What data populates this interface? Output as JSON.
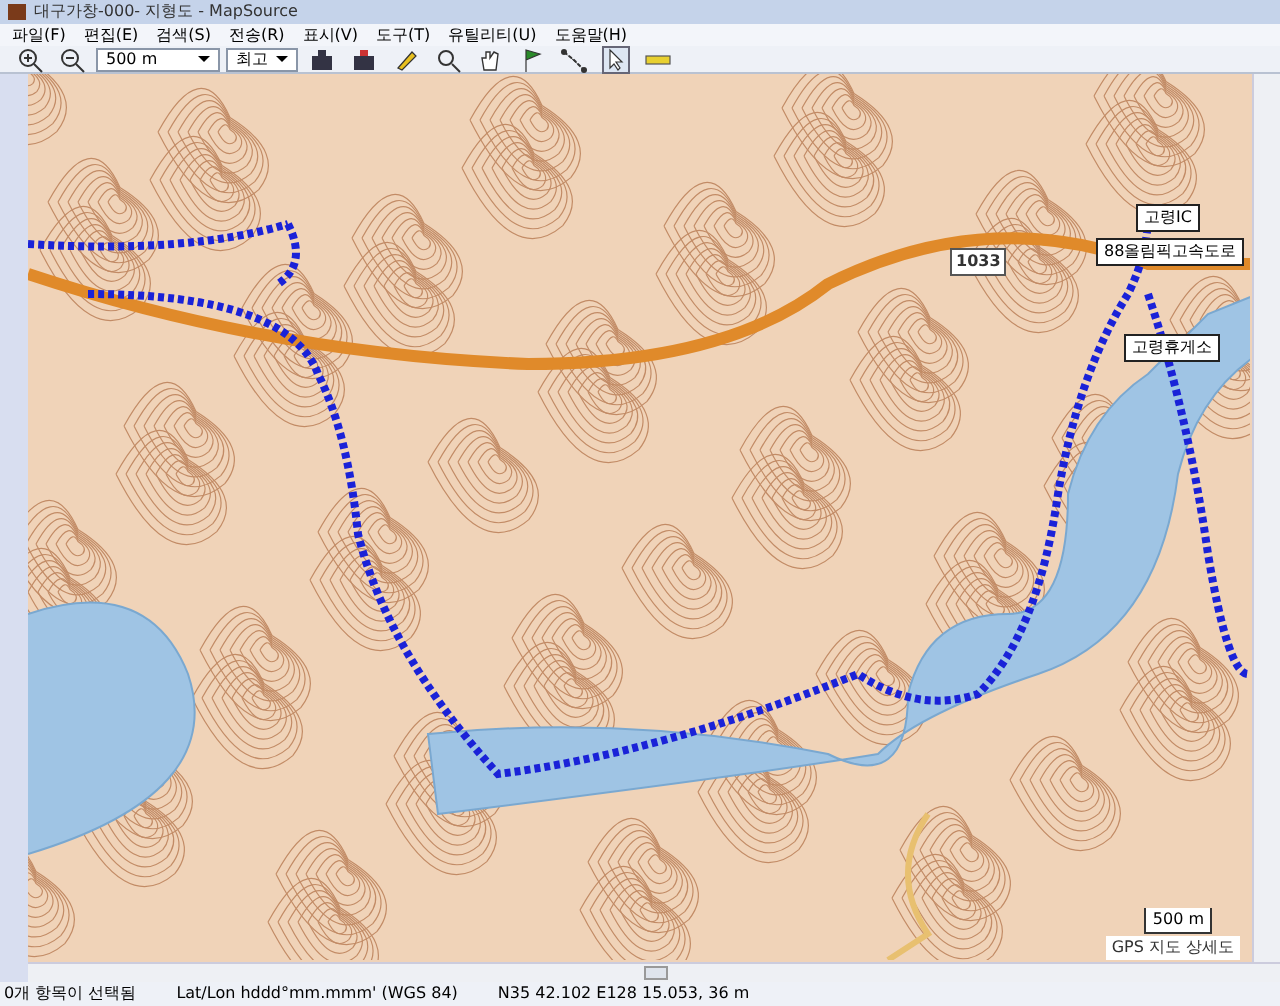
{
  "window": {
    "title": "대구가창-000- 지형도 - MapSource"
  },
  "menu": [
    "파일(F)",
    "편집(E)",
    "검색(S)",
    "전송(R)",
    "표시(V)",
    "도구(T)",
    "유틸리티(U)",
    "도움말(H)"
  ],
  "toolbar": {
    "zoom_scale": "500 m",
    "detail": "최고"
  },
  "map": {
    "labels": [
      {
        "kind": "road",
        "text": "1033"
      },
      {
        "kind": "waypoint",
        "text": "고령IC"
      },
      {
        "kind": "waypoint",
        "text": "88올림픽고속도로"
      },
      {
        "kind": "waypoint",
        "text": "고령휴게소"
      }
    ],
    "scale": "500 m",
    "overlay": "GPS 지도 상세도"
  },
  "status_bar": [
    "0개 항목이 선택됨",
    "Lat/Lon hddd°mm.mmm' (WGS 84)",
    "N35 42.102 E128 15.053, 36 m"
  ]
}
